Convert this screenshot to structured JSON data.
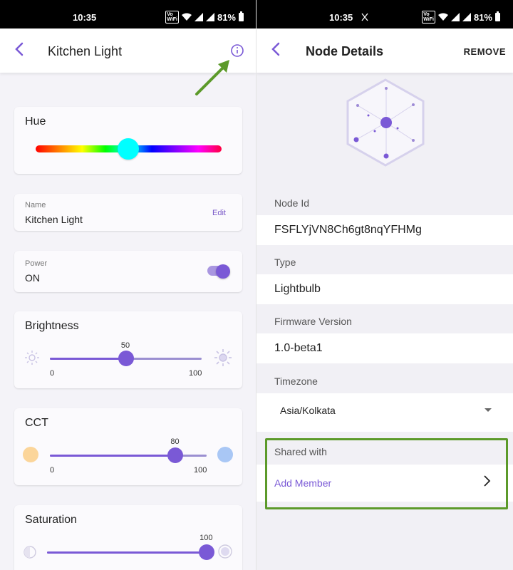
{
  "status_bar": {
    "time": "10:35",
    "indicator_text": "Vo\nWiFi",
    "battery": "81%"
  },
  "left": {
    "app_bar": {
      "title": "Kitchen Light",
      "back_icon": "chevron-left-icon",
      "info_icon": "info-icon"
    },
    "hue": {
      "title": "Hue",
      "value_color": "#00ffff"
    },
    "name": {
      "label": "Name",
      "value": "Kitchen Light",
      "edit_label": "Edit"
    },
    "power": {
      "label": "Power",
      "value": "ON",
      "toggle_on": true
    },
    "brightness": {
      "title": "Brightness",
      "value": "50",
      "min": "0",
      "max": "100",
      "level": 0.5
    },
    "cct": {
      "title": "CCT",
      "value": "80",
      "min": "0",
      "max": "100",
      "level": 0.8,
      "warm_color": "#fbd59a",
      "cool_color": "#a9c7f5"
    },
    "saturation": {
      "title": "Saturation",
      "value": "100",
      "level": 1.0
    }
  },
  "right": {
    "app_bar": {
      "title": "Node Details",
      "remove_label": "REMOVE",
      "back_icon": "chevron-left-icon"
    },
    "node_id": {
      "label": "Node Id",
      "value": "FSFLYjVN8Ch6gt8nqYFHMg"
    },
    "type": {
      "label": "Type",
      "value": "Lightbulb"
    },
    "firmware": {
      "label": "Firmware Version",
      "value": "1.0-beta1"
    },
    "timezone": {
      "label": "Timezone",
      "value": "Asia/Kolkata"
    },
    "shared": {
      "label": "Shared with",
      "add_member_label": "Add Member"
    }
  },
  "colors": {
    "accent": "#7a59d6",
    "highlight": "#5c9a2a"
  }
}
